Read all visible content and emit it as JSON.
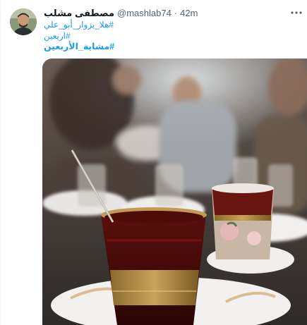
{
  "tweet": {
    "display_name": "مصطفى مشلب",
    "handle": "@mashlab74",
    "separator": "·",
    "time": "42m",
    "more_icon": "more-horizontal-icon",
    "lines": [
      "#هلا_بزوار_أبو_علي",
      "#اربعين",
      "#مشاية_الأربعين"
    ],
    "link_color": "#1d9bf0",
    "media_description_icon": "photo-image",
    "avatar_icon": "user-avatar"
  }
}
